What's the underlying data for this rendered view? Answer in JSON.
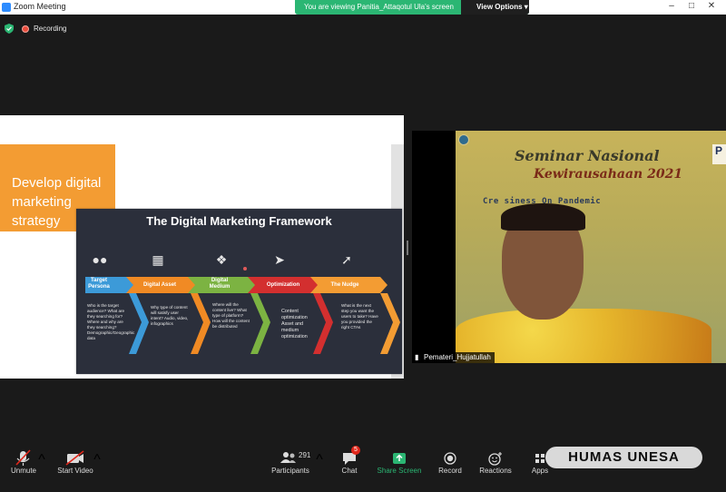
{
  "window": {
    "title": "Zoom Meeting",
    "controls": [
      "–",
      "□",
      "✕"
    ]
  },
  "banner": {
    "text": "You are viewing Panitia_Attaqotul Ula's screen",
    "view_options": "View Options ▾"
  },
  "recording": {
    "label": "Recording",
    "shield_color": "#2bb673",
    "dot_color": "#e94c3c"
  },
  "slide": {
    "heading": "Develop digital marketing strategy",
    "framework": {
      "title": "The Digital Marketing Framework",
      "steps": [
        {
          "label": "Target Persona",
          "icon": "people-icon",
          "color": "#3c9ad8",
          "desc": "Who is the target audience? What are they searching for? Where and why are they searching? Demographic/Geographic data"
        },
        {
          "label": "Digital Asset",
          "icon": "document-icon",
          "color": "#f08a24",
          "desc": "Why type of content will satisfy user intent? Audio, video, infographics"
        },
        {
          "label": "Digital Medium",
          "icon": "puzzle-icon",
          "color": "#7cb342",
          "desc": "Where will the content live? What type of platform? How will the content be distributed"
        },
        {
          "label": "Optimization",
          "icon": "rocket-icon",
          "color": "#d32f2f",
          "desc": "Content optimization Asset and medium optimization"
        },
        {
          "label": "The Nudge",
          "icon": "cursor-icon",
          "color": "#f39c33",
          "desc": "What is the next step you want the users to take? Have you provided the right CTAs"
        }
      ]
    }
  },
  "video": {
    "line1": "Seminar Nasional",
    "line2": "Kewirausahaan 2021",
    "line3": "Cre      siness On Pandemic",
    "corner": "P",
    "participant_name": "Pemateri_Hujjatullah"
  },
  "toolbar": {
    "unmute": "Unmute",
    "start_video": "Start Video",
    "participants": "Participants",
    "participants_count": "291",
    "chat": "Chat",
    "chat_badge": "5",
    "share_screen": "Share Screen",
    "record": "Record",
    "reactions": "Reactions",
    "apps": "Apps",
    "share_color": "#2bb673"
  },
  "watermark": "HUMAS UNESA"
}
